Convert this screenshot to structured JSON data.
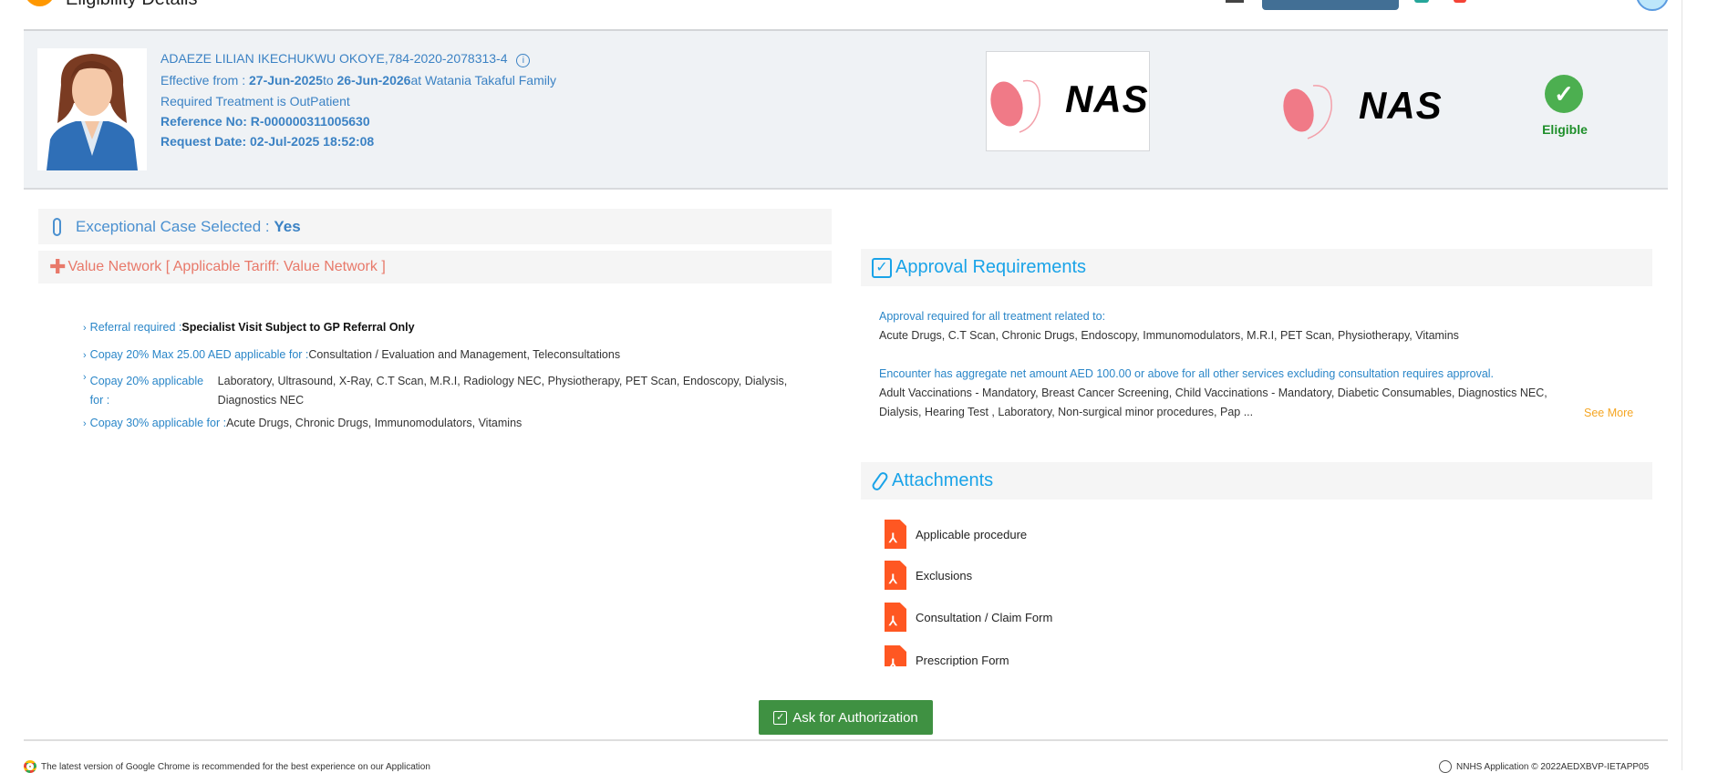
{
  "topbar": {
    "title": "Eligibility Details"
  },
  "patient": {
    "name_id": "ADAEZE LILIAN IKECHUKWU OKOYE,784-2020-2078313-4",
    "effective_label": "Effective from : ",
    "effective_from": "27-Jun-2025",
    "to_label": "to ",
    "effective_to": "26-Jun-2026",
    "at_label": "at Watania Takaful Family",
    "treatment": "Required Treatment is OutPatient",
    "reference": "Reference No: R-000000311005630",
    "request_date": "Request Date: 02-Jul-2025 18:52:08"
  },
  "logos": {
    "payer": "NAS",
    "tpa": "NAS"
  },
  "status": {
    "label": "Eligible",
    "color": "#4caf50"
  },
  "exceptional": {
    "label": "Exceptional Case Selected : ",
    "value": "Yes"
  },
  "network": {
    "label": "Value Network [ Applicable Tariff: Value Network ]"
  },
  "benefits": [
    {
      "key": "Referral required :",
      "value": "Specialist Visit Subject to GP Referral Only"
    },
    {
      "key": "Copay 20% Max 25.00 AED applicable for :",
      "value": "Consultation / Evaluation and Management, Teleconsultations"
    },
    {
      "key": "Copay 20% applicable for :",
      "value": "Laboratory, Ultrasound, X-Ray, C.T Scan, M.R.I, Radiology NEC, Physiotherapy, PET Scan, Endoscopy, Dialysis, Diagnostics NEC"
    },
    {
      "key": "Copay 30% applicable for :",
      "value": "Acute Drugs, Chronic Drugs, Immunomodulators, Vitamins"
    }
  ],
  "approval": {
    "title": "Approval Requirements",
    "heading1": "Approval required for all treatment related to:",
    "list1": "Acute Drugs, C.T Scan, Chronic Drugs, Endoscopy, Immunomodulators, M.R.I, PET Scan, Physiotherapy, Vitamins",
    "heading2": "Encounter has aggregate net amount AED 100.00 or above for all other services excluding consultation requires approval.",
    "list2a": "Adult Vaccinations - Mandatory, Breast Cancer Screening, Child Vaccinations - Mandatory, Diabetic Consumables, Diagnostics NEC,",
    "list2b": "Dialysis, Hearing Test , Laboratory, Non-surgical minor procedures, Pap ...",
    "see_more": "See More"
  },
  "attachments": {
    "title": "Attachments",
    "items": [
      "Applicable procedure",
      "Exclusions",
      "Consultation / Claim Form",
      "Prescription Form"
    ]
  },
  "actions": {
    "ask_auth": "Ask for Authorization"
  },
  "footer": {
    "left": "The latest version of Google Chrome is recommended for the best experience on our Application",
    "right": "NNHS Application © 2022AEDXBVP-IETAPP05"
  }
}
